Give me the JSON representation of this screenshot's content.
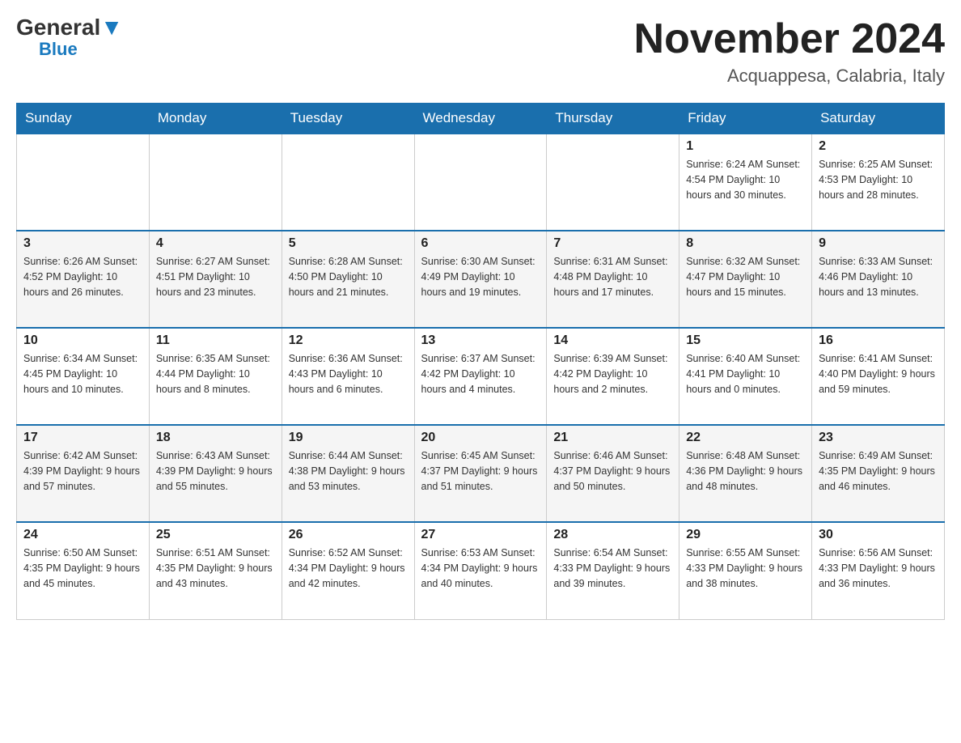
{
  "header": {
    "logo_general": "General",
    "logo_blue": "Blue",
    "month_title": "November 2024",
    "location": "Acquappesa, Calabria, Italy"
  },
  "days_of_week": [
    "Sunday",
    "Monday",
    "Tuesday",
    "Wednesday",
    "Thursday",
    "Friday",
    "Saturday"
  ],
  "weeks": [
    {
      "days": [
        {
          "number": "",
          "info": ""
        },
        {
          "number": "",
          "info": ""
        },
        {
          "number": "",
          "info": ""
        },
        {
          "number": "",
          "info": ""
        },
        {
          "number": "",
          "info": ""
        },
        {
          "number": "1",
          "info": "Sunrise: 6:24 AM\nSunset: 4:54 PM\nDaylight: 10 hours and 30 minutes."
        },
        {
          "number": "2",
          "info": "Sunrise: 6:25 AM\nSunset: 4:53 PM\nDaylight: 10 hours and 28 minutes."
        }
      ]
    },
    {
      "days": [
        {
          "number": "3",
          "info": "Sunrise: 6:26 AM\nSunset: 4:52 PM\nDaylight: 10 hours and 26 minutes."
        },
        {
          "number": "4",
          "info": "Sunrise: 6:27 AM\nSunset: 4:51 PM\nDaylight: 10 hours and 23 minutes."
        },
        {
          "number": "5",
          "info": "Sunrise: 6:28 AM\nSunset: 4:50 PM\nDaylight: 10 hours and 21 minutes."
        },
        {
          "number": "6",
          "info": "Sunrise: 6:30 AM\nSunset: 4:49 PM\nDaylight: 10 hours and 19 minutes."
        },
        {
          "number": "7",
          "info": "Sunrise: 6:31 AM\nSunset: 4:48 PM\nDaylight: 10 hours and 17 minutes."
        },
        {
          "number": "8",
          "info": "Sunrise: 6:32 AM\nSunset: 4:47 PM\nDaylight: 10 hours and 15 minutes."
        },
        {
          "number": "9",
          "info": "Sunrise: 6:33 AM\nSunset: 4:46 PM\nDaylight: 10 hours and 13 minutes."
        }
      ]
    },
    {
      "days": [
        {
          "number": "10",
          "info": "Sunrise: 6:34 AM\nSunset: 4:45 PM\nDaylight: 10 hours and 10 minutes."
        },
        {
          "number": "11",
          "info": "Sunrise: 6:35 AM\nSunset: 4:44 PM\nDaylight: 10 hours and 8 minutes."
        },
        {
          "number": "12",
          "info": "Sunrise: 6:36 AM\nSunset: 4:43 PM\nDaylight: 10 hours and 6 minutes."
        },
        {
          "number": "13",
          "info": "Sunrise: 6:37 AM\nSunset: 4:42 PM\nDaylight: 10 hours and 4 minutes."
        },
        {
          "number": "14",
          "info": "Sunrise: 6:39 AM\nSunset: 4:42 PM\nDaylight: 10 hours and 2 minutes."
        },
        {
          "number": "15",
          "info": "Sunrise: 6:40 AM\nSunset: 4:41 PM\nDaylight: 10 hours and 0 minutes."
        },
        {
          "number": "16",
          "info": "Sunrise: 6:41 AM\nSunset: 4:40 PM\nDaylight: 9 hours and 59 minutes."
        }
      ]
    },
    {
      "days": [
        {
          "number": "17",
          "info": "Sunrise: 6:42 AM\nSunset: 4:39 PM\nDaylight: 9 hours and 57 minutes."
        },
        {
          "number": "18",
          "info": "Sunrise: 6:43 AM\nSunset: 4:39 PM\nDaylight: 9 hours and 55 minutes."
        },
        {
          "number": "19",
          "info": "Sunrise: 6:44 AM\nSunset: 4:38 PM\nDaylight: 9 hours and 53 minutes."
        },
        {
          "number": "20",
          "info": "Sunrise: 6:45 AM\nSunset: 4:37 PM\nDaylight: 9 hours and 51 minutes."
        },
        {
          "number": "21",
          "info": "Sunrise: 6:46 AM\nSunset: 4:37 PM\nDaylight: 9 hours and 50 minutes."
        },
        {
          "number": "22",
          "info": "Sunrise: 6:48 AM\nSunset: 4:36 PM\nDaylight: 9 hours and 48 minutes."
        },
        {
          "number": "23",
          "info": "Sunrise: 6:49 AM\nSunset: 4:35 PM\nDaylight: 9 hours and 46 minutes."
        }
      ]
    },
    {
      "days": [
        {
          "number": "24",
          "info": "Sunrise: 6:50 AM\nSunset: 4:35 PM\nDaylight: 9 hours and 45 minutes."
        },
        {
          "number": "25",
          "info": "Sunrise: 6:51 AM\nSunset: 4:35 PM\nDaylight: 9 hours and 43 minutes."
        },
        {
          "number": "26",
          "info": "Sunrise: 6:52 AM\nSunset: 4:34 PM\nDaylight: 9 hours and 42 minutes."
        },
        {
          "number": "27",
          "info": "Sunrise: 6:53 AM\nSunset: 4:34 PM\nDaylight: 9 hours and 40 minutes."
        },
        {
          "number": "28",
          "info": "Sunrise: 6:54 AM\nSunset: 4:33 PM\nDaylight: 9 hours and 39 minutes."
        },
        {
          "number": "29",
          "info": "Sunrise: 6:55 AM\nSunset: 4:33 PM\nDaylight: 9 hours and 38 minutes."
        },
        {
          "number": "30",
          "info": "Sunrise: 6:56 AM\nSunset: 4:33 PM\nDaylight: 9 hours and 36 minutes."
        }
      ]
    }
  ]
}
